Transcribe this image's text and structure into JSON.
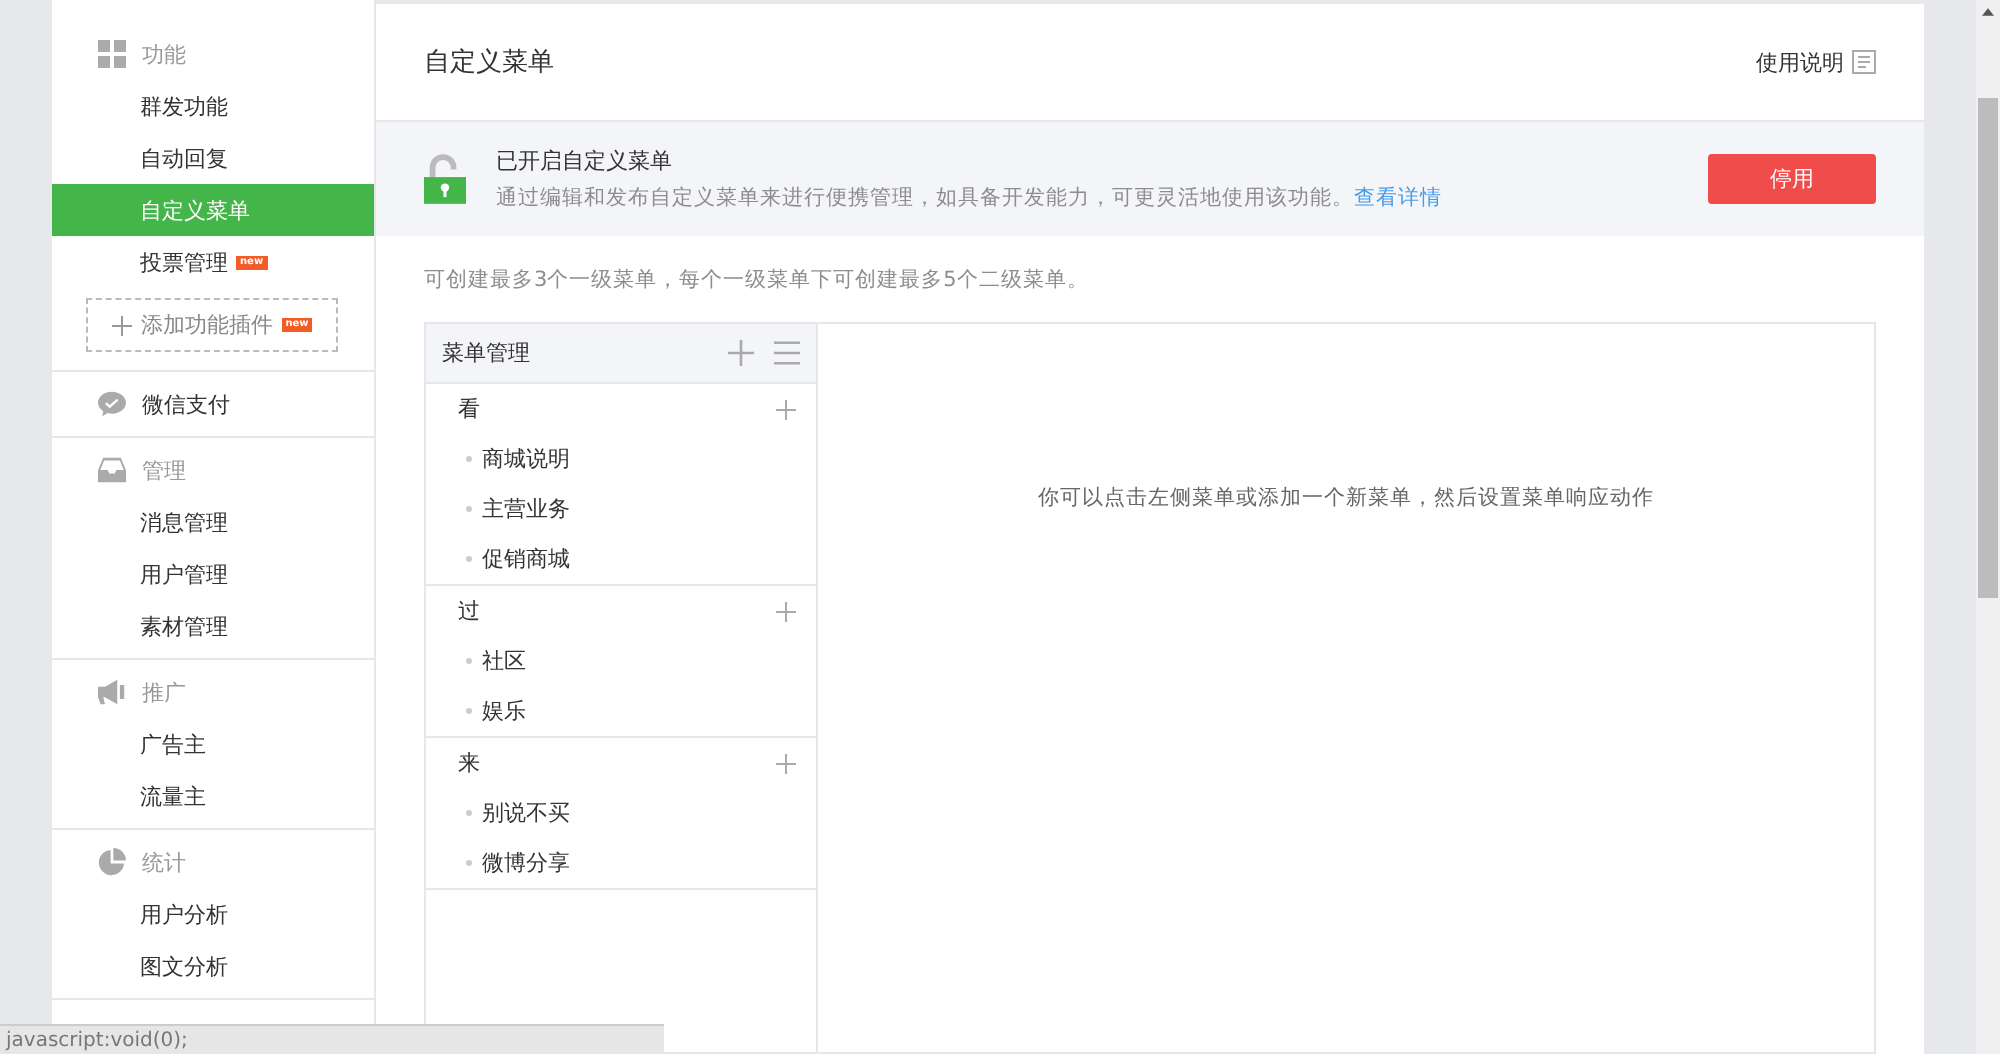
{
  "sidebar": {
    "groups": [
      {
        "title": "功能",
        "items": [
          {
            "label": "群发功能",
            "selected": false
          },
          {
            "label": "自动回复",
            "selected": false
          },
          {
            "label": "自定义菜单",
            "selected": true
          },
          {
            "label": "投票管理",
            "selected": false,
            "badge": "new"
          }
        ],
        "add_plugin": {
          "label": "添加功能插件",
          "badge": "new"
        }
      },
      {
        "title": "微信支付"
      },
      {
        "title": "管理",
        "items": [
          {
            "label": "消息管理",
            "selected": false
          },
          {
            "label": "用户管理",
            "selected": false
          },
          {
            "label": "素材管理",
            "selected": false
          }
        ]
      },
      {
        "title": "推广",
        "items": [
          {
            "label": "广告主",
            "selected": false
          },
          {
            "label": "流量主",
            "selected": false
          }
        ]
      },
      {
        "title": "统计",
        "items": [
          {
            "label": "用户分析",
            "selected": false
          },
          {
            "label": "图文分析",
            "selected": false
          }
        ]
      }
    ]
  },
  "header": {
    "title": "自定义菜单",
    "help": "使用说明"
  },
  "notice": {
    "title": "已开启自定义菜单",
    "text": "通过编辑和发布自定义菜单来进行便携管理，如具备开发能力，可更灵活地使用该功能。",
    "link": "查看详情",
    "button": "停用"
  },
  "hint": "可创建最多3个一级菜单，每个一级菜单下可创建最多5个二级菜单。",
  "menu_panel": {
    "title": "菜单管理",
    "menus": [
      {
        "label": "看",
        "children": [
          {
            "label": "商城说明"
          },
          {
            "label": "主营业务"
          },
          {
            "label": "促销商城"
          }
        ]
      },
      {
        "label": "过",
        "children": [
          {
            "label": "社区"
          },
          {
            "label": "娱乐"
          }
        ]
      },
      {
        "label": "来",
        "children": [
          {
            "label": "别说不买"
          },
          {
            "label": "微博分享"
          }
        ]
      }
    ],
    "empty_message": "你可以点击左侧菜单或添加一个新菜单，然后设置菜单响应动作"
  },
  "status_bar": "javascript:void(0);"
}
